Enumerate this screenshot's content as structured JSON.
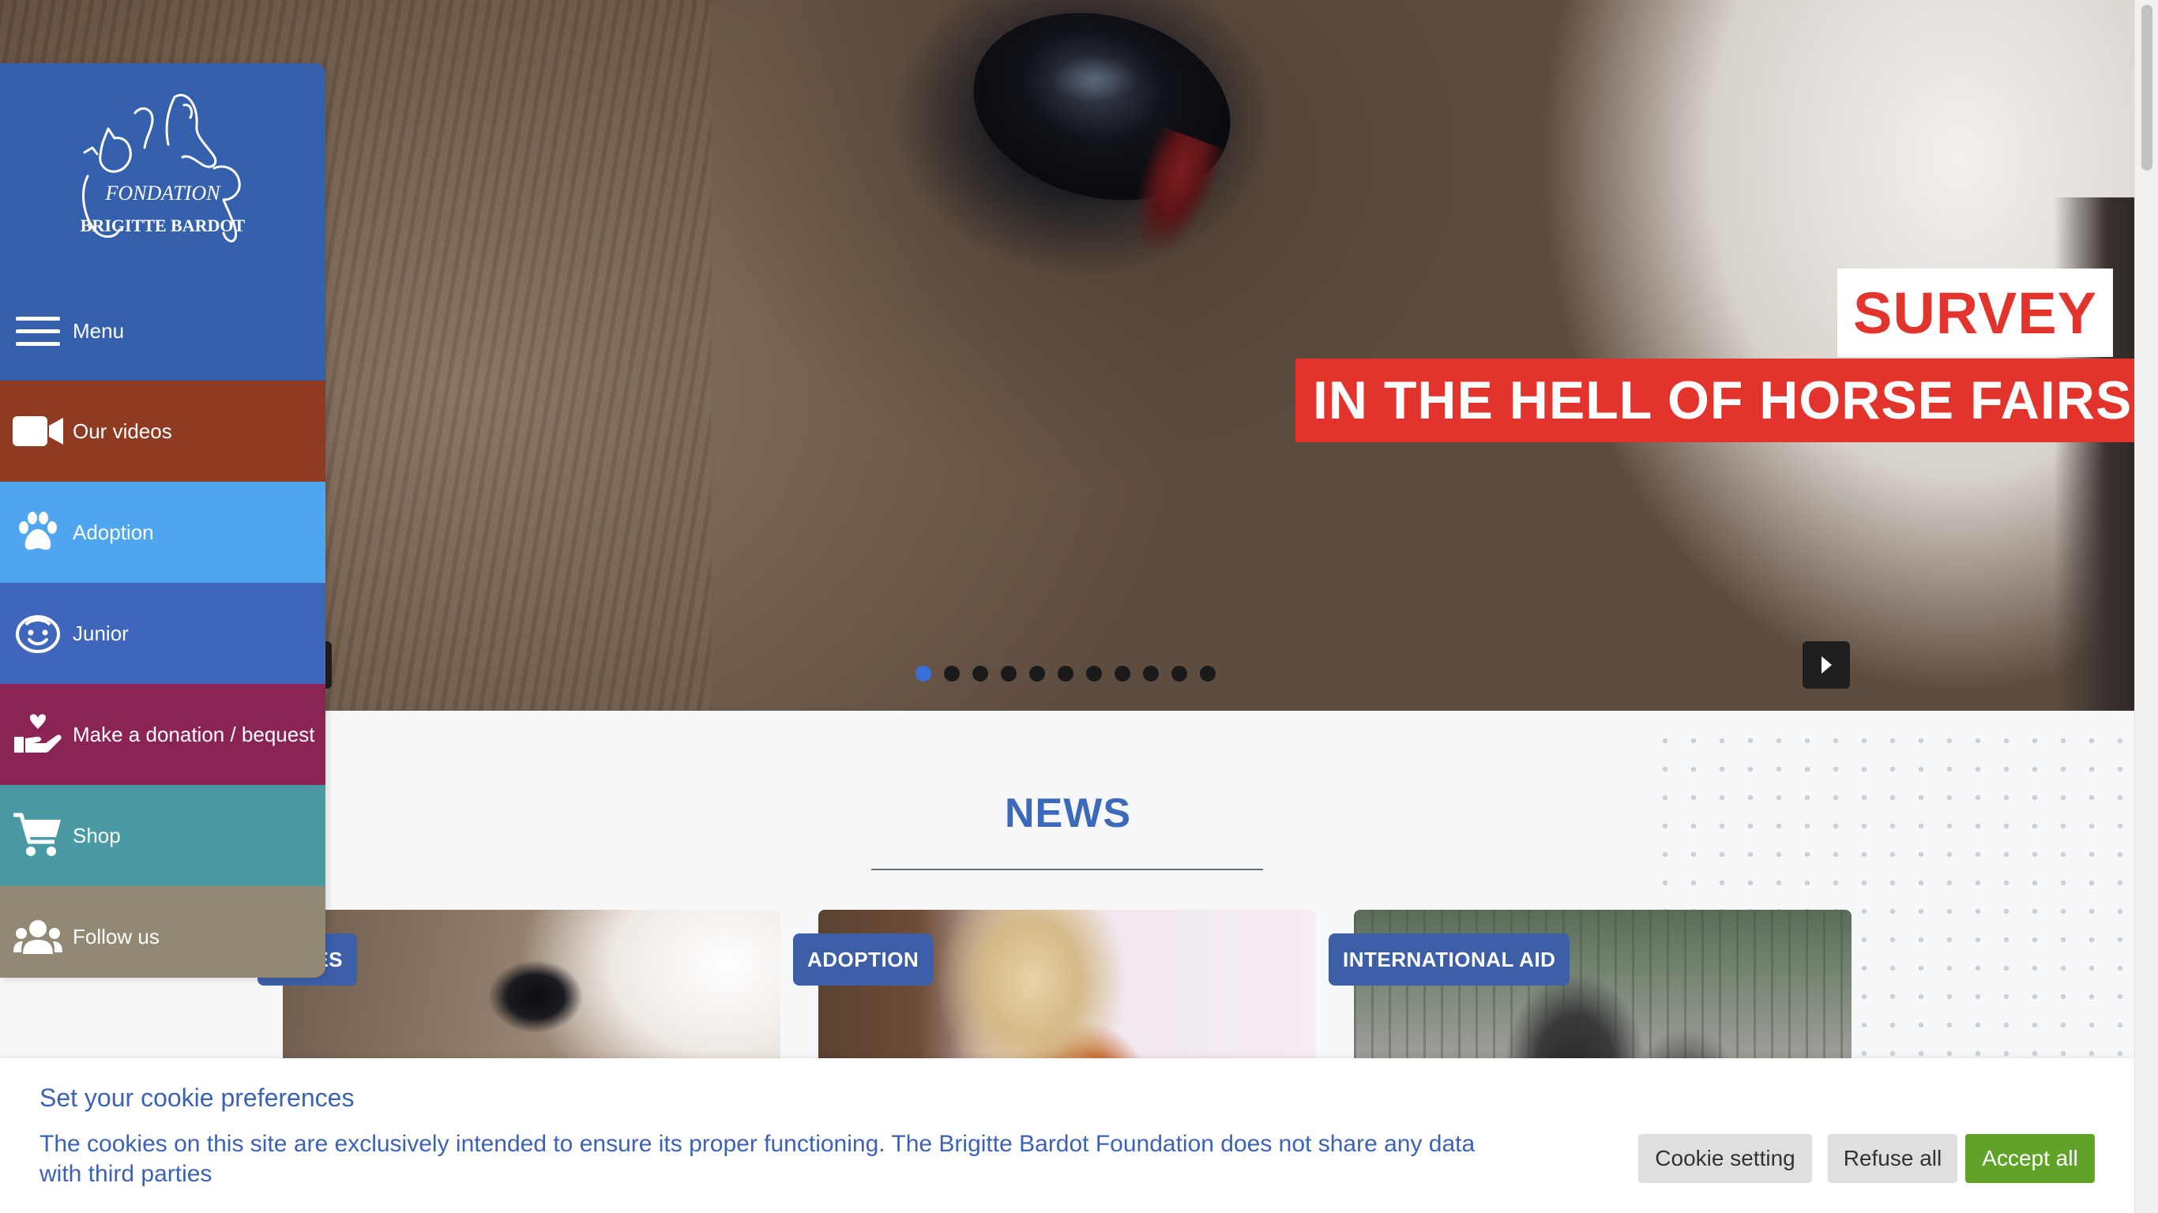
{
  "hero": {
    "kicker": "SURVEY",
    "headline": "IN THE HELL OF HORSE FAIRS",
    "slides_total": 11,
    "active_slide": 1
  },
  "sidebar": {
    "logo_text_top": "FONDATION",
    "logo_text_bottom": "BRIGITTE BARDOT",
    "items": [
      {
        "label": "Menu",
        "icon": "hamburger-icon"
      },
      {
        "label": "Our videos",
        "icon": "video-camera-icon"
      },
      {
        "label": "Adoption",
        "icon": "paw-icon"
      },
      {
        "label": "Junior",
        "icon": "smiley-face-icon"
      },
      {
        "label": "Make a donation / bequest",
        "icon": "hand-heart-icon"
      },
      {
        "label": "Shop",
        "icon": "cart-icon"
      },
      {
        "label": "Follow us",
        "icon": "people-icon"
      }
    ],
    "colors": {
      "menu": "#3560ae",
      "videos": "#8e3b22",
      "adoption": "#4ea6f0",
      "junior": "#3f66bb",
      "donation": "#8b2455",
      "shop": "#4a9aa5",
      "follow": "#938874"
    }
  },
  "news": {
    "title": "NEWS",
    "cards": [
      {
        "tag": "ES"
      },
      {
        "tag": "ADOPTION"
      },
      {
        "tag": "INTERNATIONAL AID"
      }
    ]
  },
  "cookie": {
    "title": "Set your cookie preferences",
    "text": "The cookies on this site are exclusively intended to ensure its proper functioning. The Brigitte Bardot Foundation does not share any data with third parties",
    "setting_label": "Cookie setting",
    "refuse_label": "Refuse all",
    "accept_label": "Accept all"
  },
  "colors": {
    "accent_red": "#e2332c",
    "brand_blue": "#3c62b5",
    "accept_green": "#61a229"
  }
}
